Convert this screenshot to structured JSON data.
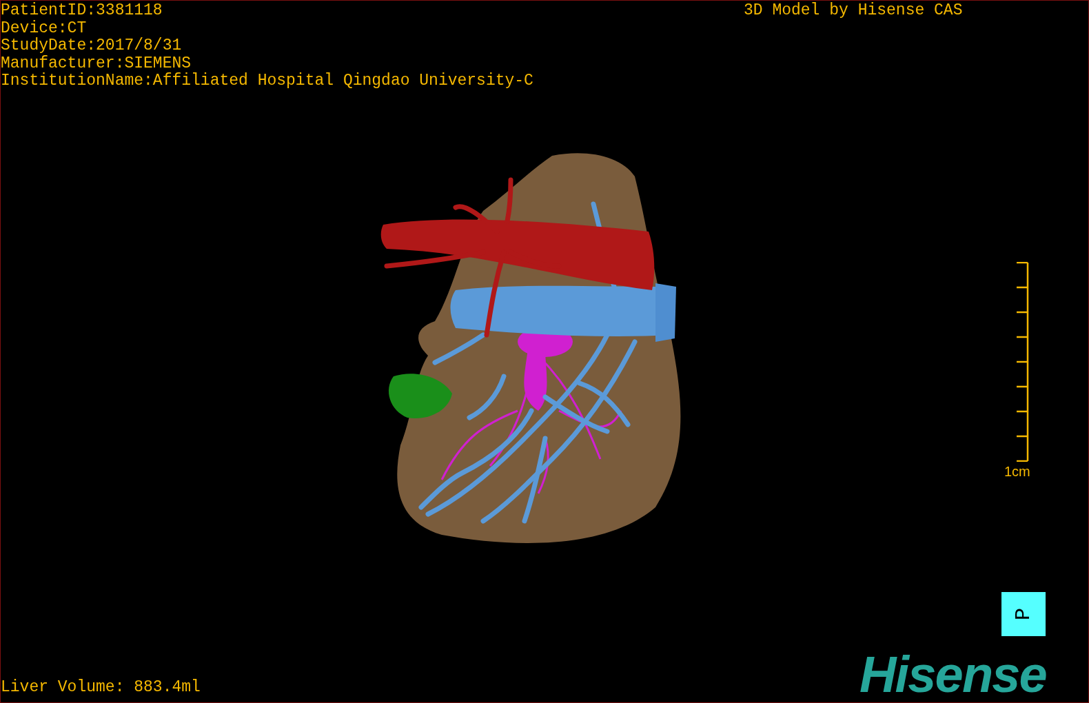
{
  "info_lines": [
    "PatientID:3381118",
    "Device:CT",
    "StudyDate:2017/8/31",
    "Manufacturer:SIEMENS",
    "InstitutionName:Affiliated Hospital Qingdao University-C"
  ],
  "model_caption": "3D Model by Hisense CAS",
  "scale_bar": {
    "label": "1cm"
  },
  "orientation_marker": {
    "label": "P"
  },
  "logo": {
    "text": "Hisense"
  },
  "liver_volume": "Liver Volume: 883.4ml"
}
